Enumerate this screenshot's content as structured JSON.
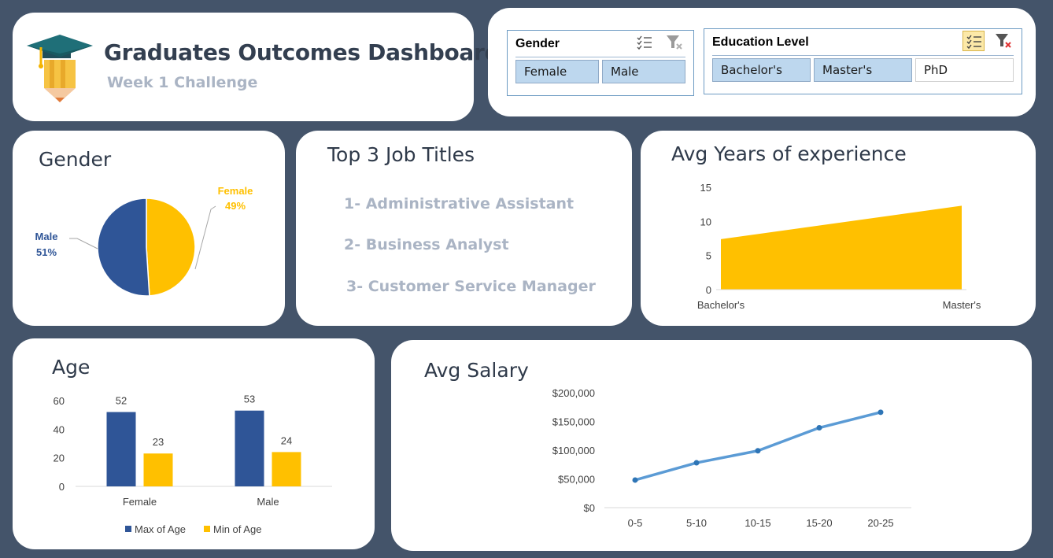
{
  "header": {
    "title": "Graduates Outcomes Dashboard",
    "subtitle": "Week 1 Challenge"
  },
  "slicers": {
    "gender": {
      "title": "Gender",
      "options": [
        {
          "label": "Female",
          "selected": true
        },
        {
          "label": "Male",
          "selected": true
        }
      ]
    },
    "education": {
      "title": "Education Level",
      "options": [
        {
          "label": "Bachelor's",
          "selected": true
        },
        {
          "label": "Master's",
          "selected": true
        },
        {
          "label": "PhD",
          "selected": false
        }
      ]
    }
  },
  "gender_card": {
    "title": "Gender"
  },
  "jobs_card": {
    "title": "Top 3 Job Titles",
    "items": [
      "1- Administrative Assistant",
      "2- Business Analyst",
      "3- Customer Service Manager"
    ]
  },
  "years_card": {
    "title": "Avg Years of experience"
  },
  "age_card": {
    "title": "Age"
  },
  "salary_card": {
    "title": "Avg Salary"
  },
  "colors": {
    "background": "#44546a",
    "blue": "#2f5597",
    "yellow": "#ffc000",
    "line": "#5b9bd5",
    "slicer_selected": "#bdd7ee"
  },
  "chart_data": [
    {
      "id": "gender",
      "type": "pie",
      "categories": [
        "Female",
        "Male"
      ],
      "values": [
        49,
        51
      ],
      "labels": [
        "49%",
        "51%"
      ],
      "colors": [
        "#ffc000",
        "#2f5597"
      ]
    },
    {
      "id": "years",
      "type": "area",
      "categories": [
        "Bachelor's",
        "Master's"
      ],
      "values": [
        7.4,
        12.3
      ],
      "ylim": [
        0,
        15
      ],
      "yticks": [
        0,
        5,
        10,
        15
      ],
      "color": "#ffc000"
    },
    {
      "id": "age",
      "type": "bar",
      "categories": [
        "Female",
        "Male"
      ],
      "series": [
        {
          "name": "Max of Age",
          "values": [
            52,
            53
          ],
          "color": "#2f5597"
        },
        {
          "name": "Min of Age",
          "values": [
            23,
            24
          ],
          "color": "#ffc000"
        }
      ],
      "ylim": [
        0,
        60
      ],
      "yticks": [
        0,
        20,
        40,
        60
      ],
      "legend": "bottom"
    },
    {
      "id": "salary",
      "type": "line",
      "categories": [
        "0-5",
        "5-10",
        "10-15",
        "15-20",
        "20-25"
      ],
      "values": [
        48000,
        78000,
        99000,
        139000,
        166000
      ],
      "ylim": [
        0,
        200000
      ],
      "yticks": [
        0,
        50000,
        100000,
        150000,
        200000
      ],
      "ytick_labels": [
        "$0",
        "$50,000",
        "$100,000",
        "$150,000",
        "$200,000"
      ],
      "color": "#5b9bd5"
    }
  ]
}
